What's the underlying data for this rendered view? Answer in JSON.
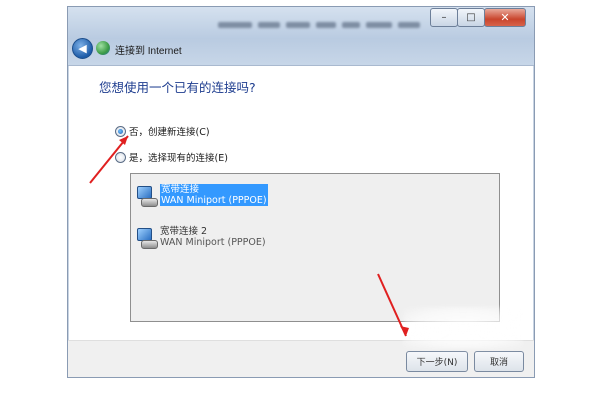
{
  "window": {
    "title": "连接到 Internet",
    "controls": {
      "minimize": "–",
      "maximize": "□",
      "close": "✕"
    }
  },
  "content": {
    "question": "您想使用一个已有的连接吗?",
    "options": [
      {
        "label": "否，创建新连接(C)",
        "checked": true
      },
      {
        "label": "是，选择现有的连接(E)",
        "checked": false
      }
    ],
    "connections": [
      {
        "name": "宽带连接",
        "device": "WAN Miniport (PPPOE)",
        "selected": true
      },
      {
        "name": "宽带连接 2",
        "device": "WAN Miniport (PPPOE)",
        "selected": false
      }
    ]
  },
  "footer": {
    "next_label": "下一步(N)",
    "cancel_label": "取消"
  },
  "colors": {
    "accent": "#1e3d8f",
    "selection": "#3399ff",
    "annotation_arrow": "#e02020"
  },
  "icons": [
    "back-arrow-icon",
    "network-globe-icon",
    "broadband-connection-icon"
  ]
}
